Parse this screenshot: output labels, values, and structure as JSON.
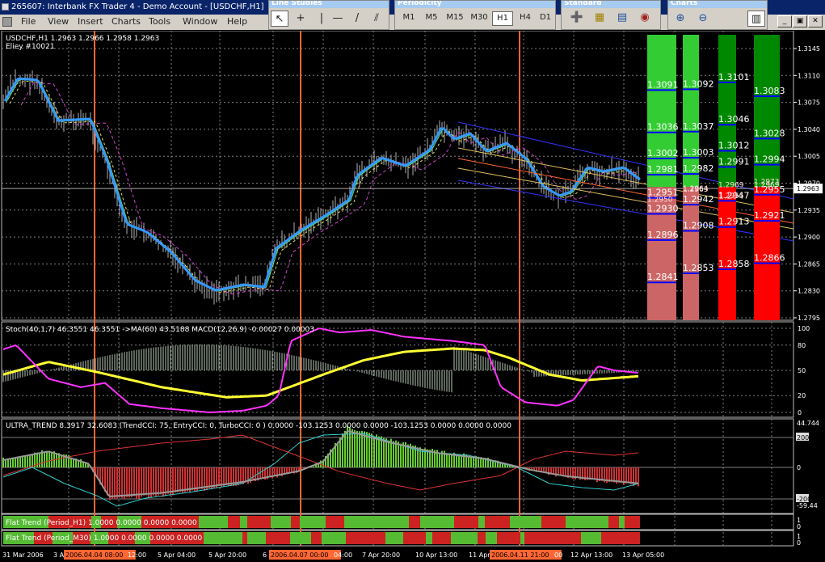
{
  "window": {
    "title": "265607: Interbank FX Trader 4 - Demo Account - [USDCHF,H1]"
  },
  "menu": [
    "File",
    "View",
    "Insert",
    "Charts",
    "Tools",
    "Window",
    "Help"
  ],
  "toolbars": {
    "line_studies": {
      "title": "Line Studies"
    },
    "periodicity": {
      "title": "Periodicity",
      "buttons": [
        "M1",
        "M5",
        "M15",
        "M30",
        "H1",
        "H4",
        "D1"
      ],
      "active": "H1"
    },
    "standard": {
      "title": "Standard"
    },
    "charts": {
      "title": "Charts"
    }
  },
  "icons": [
    "app-icon",
    "cursor-icon",
    "crosshair-icon",
    "vertical-line-icon",
    "horizontal-line-icon",
    "trendline-icon",
    "equidistant-channel-icon",
    "fibonacci-icon",
    "text-icon",
    "new-chart-icon",
    "profiles-icon",
    "market-watch-icon",
    "data-window-icon",
    "zoom-in-icon",
    "zoom-out-icon",
    "tile-windows-icon",
    "minimize-icon",
    "restore-icon",
    "close-icon"
  ],
  "chart": {
    "symbol_header": "USDCHF,H1  1.2963 1.2966 1.2958 1.2963",
    "ea_label": "Eliey #10021",
    "current_price": "1.2963",
    "price_ticks": [
      "1.3145",
      "1.3110",
      "1.3075",
      "1.3040",
      "1.3005",
      "1.2970",
      "1.2935",
      "1.2900",
      "1.2865",
      "1.2830",
      "1.2795"
    ],
    "level_columns": [
      {
        "colors": [
          "#33cc33",
          "#cc6666"
        ],
        "upper": [
          "1.3091",
          "1.3036",
          "1.3002",
          "1.2981"
        ],
        "lower": [
          "1.2951",
          "1.2930",
          "1.2896",
          "1.2841"
        ],
        "extra": [
          "1.2950"
        ]
      },
      {
        "colors": [
          "#33cc33",
          "#cc6666"
        ],
        "upper": [
          "1.3092",
          "1.3037",
          "1.3003",
          "1.2982"
        ],
        "lower": [
          "1.2942",
          "1.2908",
          "1.2853"
        ],
        "extra": [
          "1.2964",
          "1.2963"
        ]
      },
      {
        "colors": [
          "#008800",
          "#ff0000"
        ],
        "upper": [
          "1.3101",
          "1.3046",
          "1.3012",
          "1.2991"
        ],
        "lower": [
          "1.2947",
          "1.2913",
          "1.2858"
        ],
        "extra": [
          "1.2969",
          "1.2955"
        ]
      },
      {
        "colors": [
          "#008800",
          "#ff0000"
        ],
        "upper": [
          "1.3083",
          "1.3028",
          "1.2994"
        ],
        "lower": [
          "1.2955",
          "1.2921",
          "1.2866"
        ],
        "extra": [
          "1.2969",
          "1.2973"
        ]
      }
    ],
    "stoch_header": "Stoch(40,1,7) 46.3551 46.3551  ->MA(60) 43.5188  MACD(12,26,9) -0.00027 0.00003",
    "stoch_ticks": [
      "100",
      "80",
      "50",
      "20",
      "0"
    ],
    "ultra_header": "ULTRA_TREND 8.3917 32.6083  (TrendCCI: 75, EntryCCI: 0, TurboCCI: 0 )  0.0000 -103.1253 0.0000 0.0000 -103.1253 0.0000 0.0000 0.0000",
    "ultra_ticks": [
      "44.744",
      "200",
      "0",
      "-200",
      "-59.44"
    ],
    "flat_h1_header": "Flat Trend (Period_H1) 1.0000 0.0000 0.0000 0.0000",
    "flat_m30_header": "Flat Trend (Period_M30) 1.0000 0.0000 0.0000 0.0000",
    "flat_ticks": [
      "1",
      "0"
    ],
    "time_labels": [
      "31 Mar 2006",
      "3 Apr 20",
      "2006.04.04 08:00",
      "12:00",
      "5 Apr 04:00",
      "5 Apr 20:00",
      "6 A",
      "2006.04.07 00:00",
      "04:00",
      "7 Apr 20:00",
      "10 Apr 13:00",
      "11 Apr",
      "2006.04.11 21:00",
      "00",
      "12 Apr 13:00",
      "13 Apr 05:00"
    ],
    "time_highlight_color": "#ff6633"
  },
  "colors": {
    "background": "#000000",
    "candle": "#b0b0b0",
    "ma_fast": "#3399ff",
    "ma_green": "#66dd66",
    "ma_yellow_dash": "#e0e060",
    "ma_magenta_dash": "#d040d0",
    "channel_blue": "#3333ff",
    "channel_yellow": "#e0c060",
    "channel_orange": "#ff6633",
    "vline": "#ff6633",
    "stoch": "#ff33ff",
    "stoch_ma": "#ffff33",
    "grid": "#808080",
    "hist_green": "#66cc33",
    "hist_red": "#cc3333",
    "flat_green": "#55bb33",
    "flat_red": "#cc2222"
  }
}
